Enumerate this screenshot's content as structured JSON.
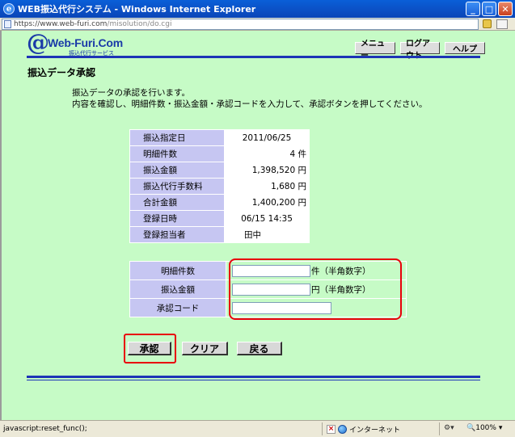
{
  "window": {
    "title": "WEB振込代行システム - Windows Internet Explorer",
    "ie_icon_glyph": "e",
    "minimize_glyph": "_",
    "maximize_glyph": "□",
    "close_glyph": "✕"
  },
  "address_bar": {
    "url_prefix": "https://www.web-furi.com",
    "url_rest": "/misolution/do.cgi"
  },
  "logo": {
    "at": "@",
    "name": "Web-Furi.Com",
    "sub": "振込代行サービス"
  },
  "nav": {
    "menu": "メニュー",
    "logout": "ログアウト",
    "help": "ヘルプ"
  },
  "page_title": "振込データ承認",
  "description": {
    "line1": "振込データの承認を行います。",
    "line2": "内容を確認し、明細件数・振込金額・承認コードを入力して、承認ボタンを押してください。"
  },
  "summary": [
    {
      "label": "振込指定日",
      "value": "2011/06/25"
    },
    {
      "label": "明細件数",
      "value": "4 件"
    },
    {
      "label": "振込金額",
      "value": "1,398,520 円"
    },
    {
      "label": "振込代行手数料",
      "value": "1,680 円"
    },
    {
      "label": "合計金額",
      "value": "1,400,200 円"
    },
    {
      "label": "登録日時",
      "value": "06/15 14:35"
    },
    {
      "label": "登録担当者",
      "value": "田中"
    }
  ],
  "inputs": {
    "count": {
      "label": "明細件数",
      "value": "",
      "suffix": "件（半角数字）"
    },
    "amount": {
      "label": "振込金額",
      "value": "",
      "suffix": "円（半角数字）"
    },
    "code": {
      "label": "承認コード",
      "value": ""
    }
  },
  "actions": {
    "approve": "承認",
    "clear": "クリア",
    "back": "戻る"
  },
  "status": {
    "text": "javascript:reset_func();",
    "zone": "インターネット",
    "zoom": "100%"
  },
  "colors": {
    "page_bg": "#c6fbc6",
    "label_bg": "#c6c6f2",
    "rule": "#1d34b6",
    "highlight": "#e8000b"
  }
}
